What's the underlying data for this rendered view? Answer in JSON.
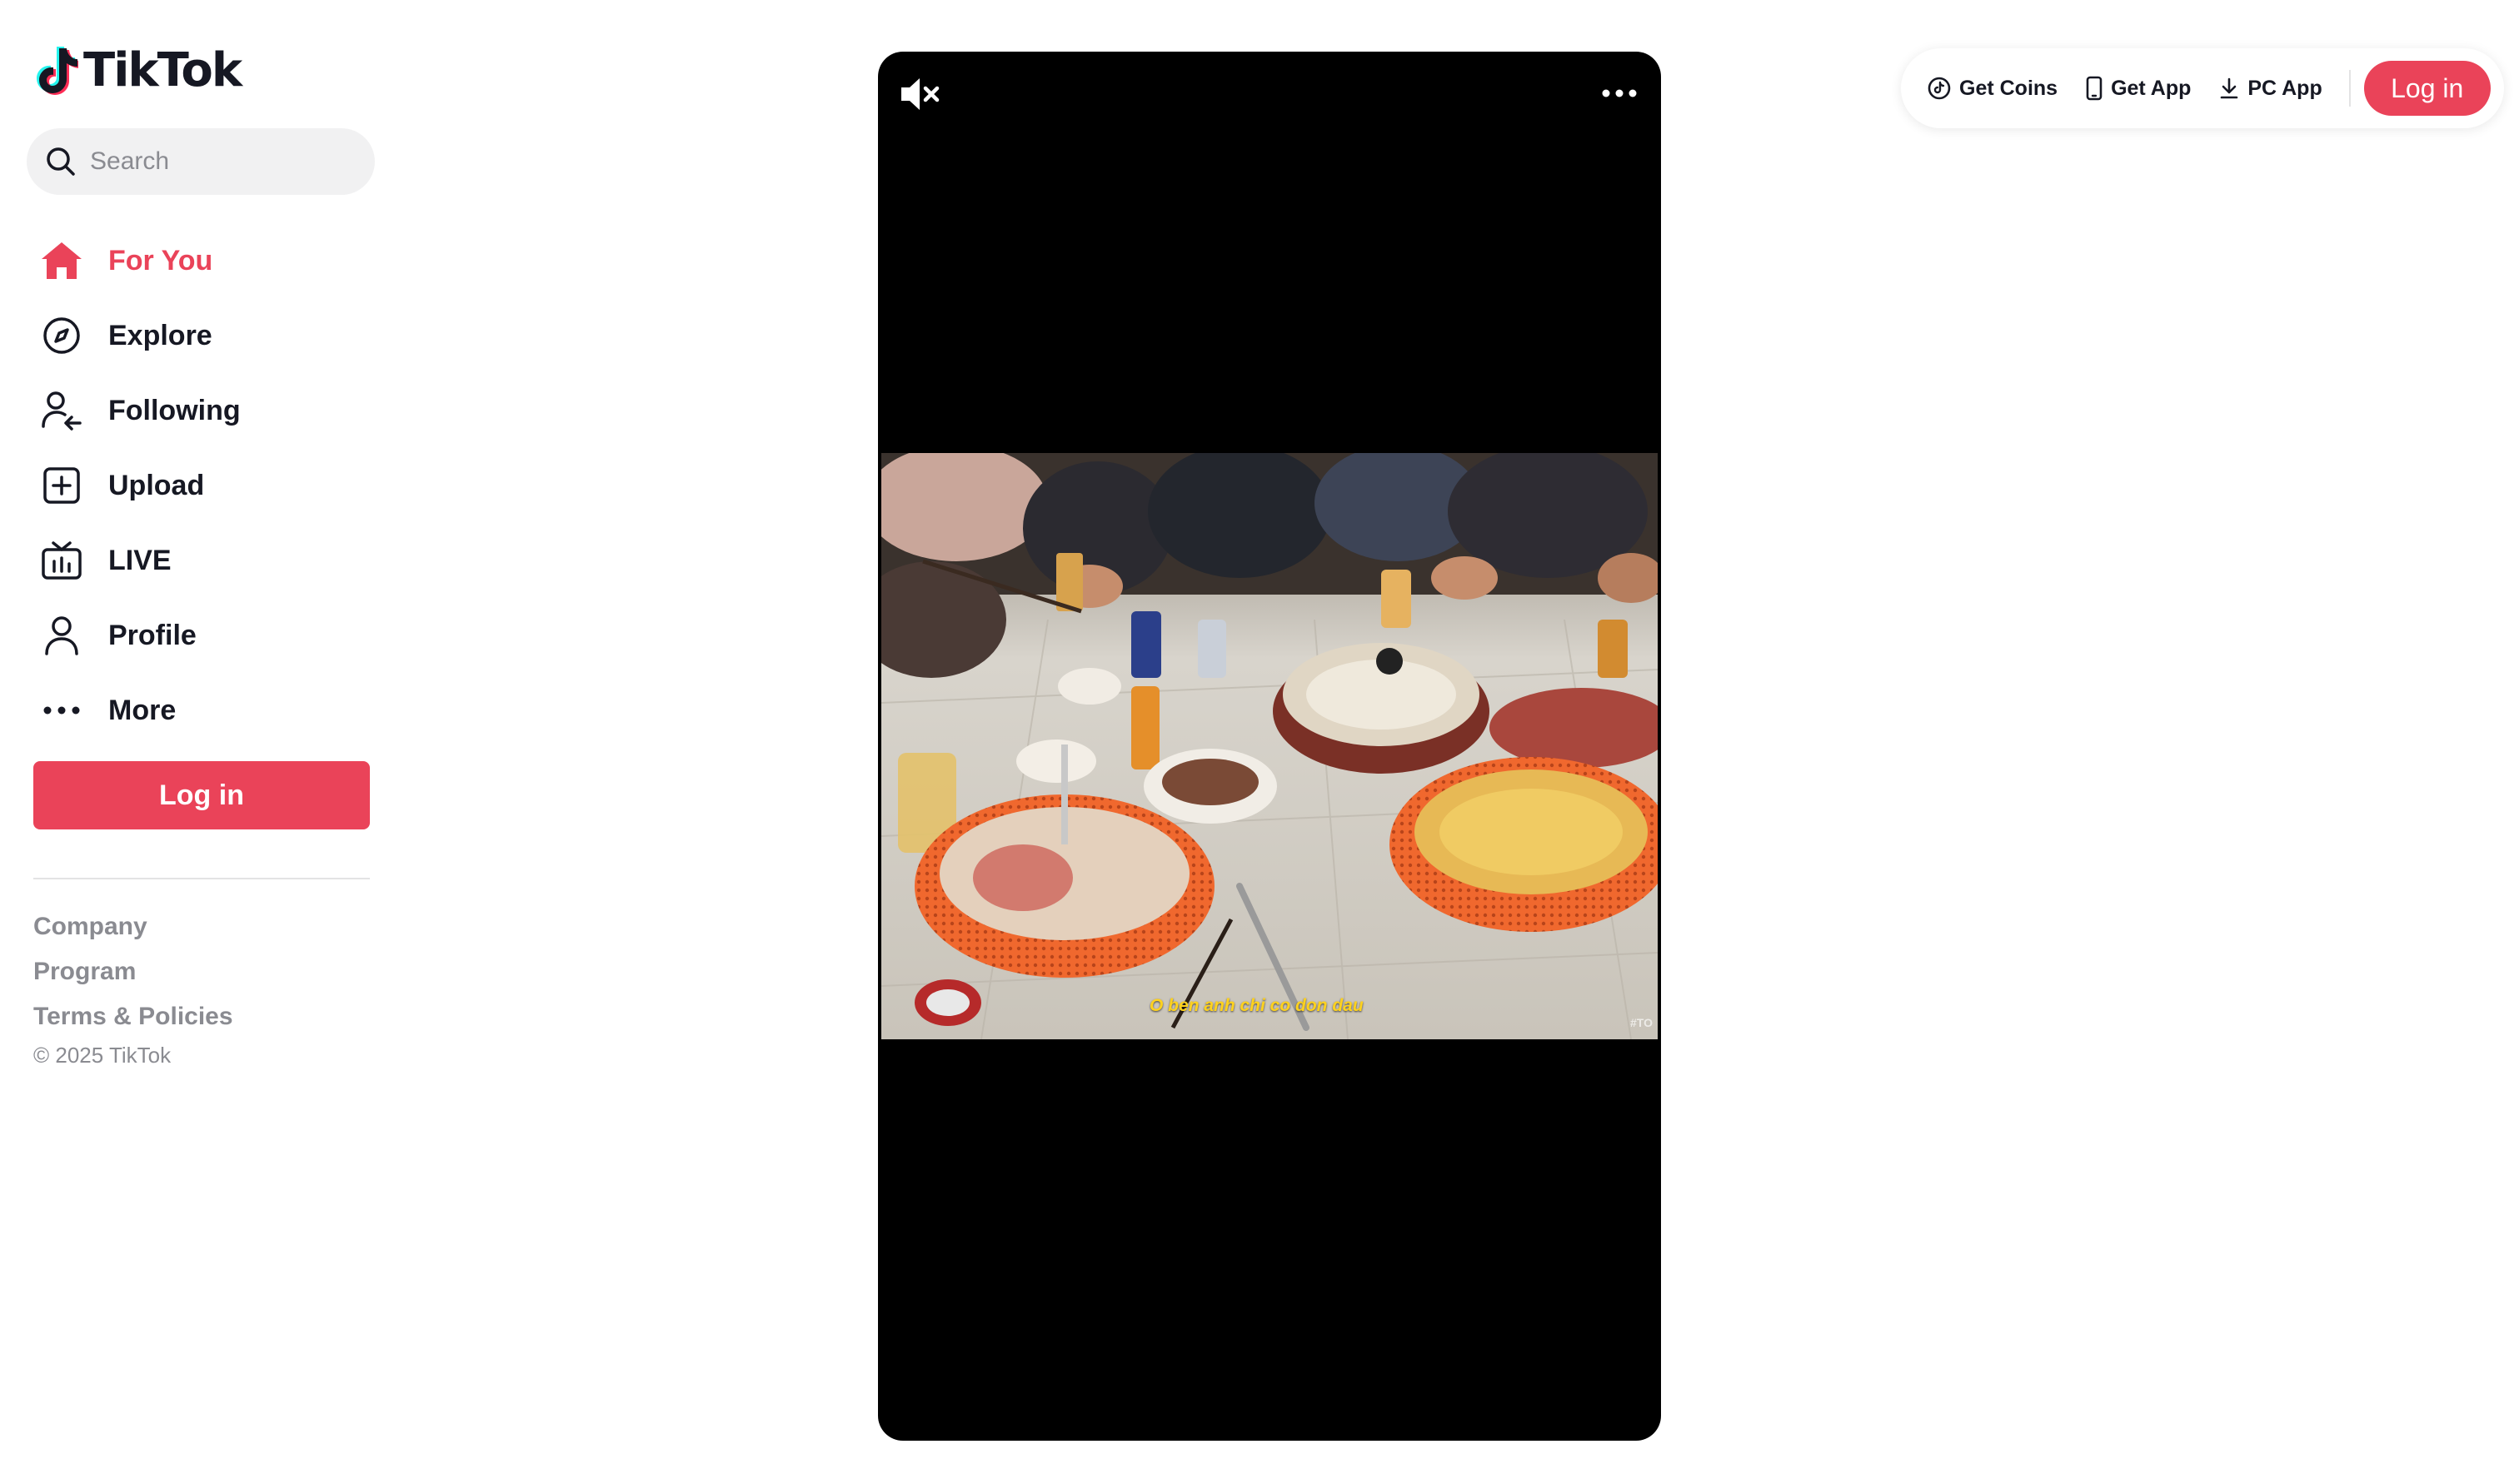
{
  "brand": {
    "name": "TikTok",
    "accent": "#ea4359"
  },
  "search": {
    "placeholder": "Search"
  },
  "nav": {
    "items": [
      {
        "label": "For You",
        "icon": "home-icon",
        "active": true
      },
      {
        "label": "Explore",
        "icon": "compass-icon"
      },
      {
        "label": "Following",
        "icon": "following-icon"
      },
      {
        "label": "Upload",
        "icon": "upload-icon"
      },
      {
        "label": "LIVE",
        "icon": "live-tv-icon"
      },
      {
        "label": "Profile",
        "icon": "profile-icon"
      },
      {
        "label": "More",
        "icon": "more-dots-icon"
      }
    ]
  },
  "sidebar": {
    "login_label": "Log in"
  },
  "footer": {
    "links": [
      "Company",
      "Program",
      "Terms & Policies"
    ],
    "copyright": "© 2025 TikTok"
  },
  "video": {
    "caption": "O ben anh chi co don dau",
    "watermark": "#TO"
  },
  "topbar": {
    "get_coins": "Get Coins",
    "get_app": "Get App",
    "pc_app": "PC App",
    "login_label": "Log in"
  }
}
